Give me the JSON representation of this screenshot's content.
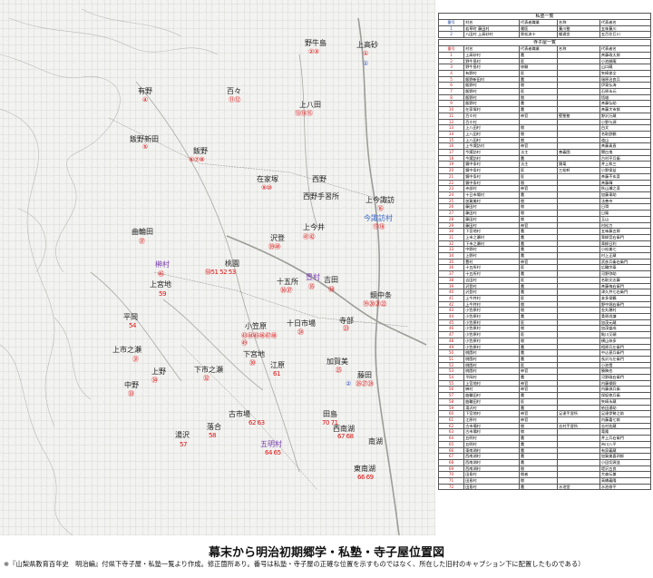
{
  "title": "幕末から明治初期郷学・私塾・寺子屋位置図",
  "note": "※『山梨県教育百年史　明治編』付県下寺子屋・私塾一覧より作成。修正箇所あり。番号は私塾・寺子屋の正確な位置を示すものではなく、所在した旧村のキャプション下に配置したものである）",
  "map": {
    "places": [
      {
        "name": "野牛島",
        "circles": "②③",
        "color": "black"
      },
      {
        "name": "上高砂",
        "circles": "①",
        "blue_circles": "①",
        "color": "black"
      },
      {
        "name": "有野",
        "circles": "④",
        "color": "black"
      },
      {
        "name": "百々",
        "circles": "⑪⑫",
        "color": "black"
      },
      {
        "name": "上八田",
        "circles": "⑬⑭⑮",
        "color": "black"
      },
      {
        "name": "飯野新田",
        "circles": "⑤",
        "color": "black"
      },
      {
        "name": "飯野",
        "circles": "⑥⑦⑧",
        "color": "black"
      },
      {
        "name": "在家塚",
        "circles": "⑨⑩",
        "color": "black"
      },
      {
        "name": "西野",
        "circles": "",
        "color": "black"
      },
      {
        "name": "西野手習所",
        "circles": "",
        "color": "black"
      },
      {
        "name": "上今諏訪",
        "circles": "⑯",
        "color": "black"
      },
      {
        "name": "今諏訪村",
        "circles": "⑰⑱",
        "color": "blue"
      },
      {
        "name": "曲輪田",
        "circles": "㊲",
        "color": "black"
      },
      {
        "name": "上今井",
        "circles": "㊶㊷",
        "color": "black"
      },
      {
        "name": "沢登",
        "circles": "㊴㊵",
        "color": "black"
      },
      {
        "name": "榊村",
        "circles": "㊻",
        "color": "purple"
      },
      {
        "name": "桃園",
        "circles": "㊿51 52 53",
        "color": "black"
      },
      {
        "name": "十五所",
        "circles": "㊱㊲",
        "color": "black"
      },
      {
        "name": "豊村",
        "circles": "㉟",
        "color": "purple"
      },
      {
        "name": "吉田",
        "circles": "㊳",
        "color": "black"
      },
      {
        "name": "上宮地",
        "circles": "59",
        "color": "black"
      },
      {
        "name": "鏡中条",
        "circles": "⑲⑳㉑㉒",
        "color": "black"
      },
      {
        "name": "平岡",
        "circles": "54",
        "color": "black"
      },
      {
        "name": "小笠原",
        "circles": "㊸㊹㊺㊻㊼㊽㊾",
        "color": "black"
      },
      {
        "name": "十日市場",
        "circles": "㉔",
        "color": "black"
      },
      {
        "name": "寺部",
        "circles": "㉓",
        "color": "black"
      },
      {
        "name": "上市之瀬",
        "circles": "㉛",
        "color": "black"
      },
      {
        "name": "下宮地",
        "circles": "㉚",
        "color": "black"
      },
      {
        "name": "加賀美",
        "circles": "㉕",
        "color": "black"
      },
      {
        "name": "上野",
        "circles": "㉞",
        "color": "black"
      },
      {
        "name": "下市之瀬",
        "circles": "㉜",
        "color": "black"
      },
      {
        "name": "江原",
        "circles": "61",
        "color": "black"
      },
      {
        "name": "藤田",
        "circles": "㉖㉗㉘",
        "blue_circles": "②",
        "color": "black"
      },
      {
        "name": "中野",
        "circles": "㉝",
        "color": "black"
      },
      {
        "name": "古市場",
        "circles": "62 63",
        "color": "black"
      },
      {
        "name": "落合",
        "circles": "58",
        "color": "black"
      },
      {
        "name": "田島",
        "circles": "70 71",
        "color": "black"
      },
      {
        "name": "西南湖",
        "circles": "67 68",
        "color": "black"
      },
      {
        "name": "湯沢",
        "circles": "57",
        "color": "black"
      },
      {
        "name": "五明村",
        "circles": "64 65",
        "color": "purple"
      },
      {
        "name": "南湖",
        "circles": "",
        "color": "black"
      },
      {
        "name": "東南湖",
        "circles": "66 69",
        "color": "black"
      }
    ]
  },
  "private_schools": {
    "title": "私塾一覧",
    "headers": [
      "番号",
      "村名",
      "代表者職業",
      "名称",
      "代表者名"
    ],
    "rows": [
      [
        "1",
        "若草町 藤田村",
        "儒医",
        "蒹川塾",
        "五味蒹川"
      ],
      [
        "2",
        "八田村 上高砂村",
        "黒松流十",
        "蝶適舎",
        "五百住巨川"
      ]
    ]
  },
  "temple_schools": {
    "title": "寺子屋一覧",
    "headers": [
      "番号",
      "村名",
      "代表者職業",
      "名称",
      "代表者名"
    ],
    "rows": [
      [
        "1",
        "上高砂村",
        "農",
        "",
        "斉藤政太郎"
      ],
      [
        "2",
        "野牛島村",
        "医",
        "",
        "小池順庵"
      ],
      [
        "3",
        "野牛島村",
        "修験",
        "",
        "山口蔵"
      ],
      [
        "4",
        "有野村",
        "医",
        "",
        "矢崎俊全"
      ],
      [
        "5",
        "飯野新田村",
        "農",
        "",
        "瑞原治良兵"
      ],
      [
        "6",
        "飯野村",
        "僧",
        "",
        "伊東弘海"
      ],
      [
        "7",
        "飯野村",
        "医",
        "",
        "石原永元"
      ],
      [
        "8",
        "飯野村",
        "僧",
        "",
        "悟雄"
      ],
      [
        "9",
        "飯野村",
        "農",
        "",
        "斉藤弘助"
      ],
      [
        "10",
        "在家塚村",
        "農",
        "",
        "斉藤大市郎"
      ],
      [
        "11",
        "百々村",
        "神官",
        "堅聖塾",
        "野沢万蔵"
      ],
      [
        "12",
        "百々村",
        "",
        "",
        "小野与源"
      ],
      [
        "13",
        "上八田村",
        "僧",
        "",
        "白文"
      ],
      [
        "14",
        "上八田村",
        "僧",
        "",
        "名取鉄観"
      ],
      [
        "15",
        "上八田村",
        "僧",
        "",
        "道山"
      ],
      [
        "16",
        "上今諏訪村",
        "神官",
        "",
        "斉藤真直"
      ],
      [
        "17",
        "今諏訪村",
        "法主",
        "善義園",
        "関白鬼"
      ],
      [
        "18",
        "今諏訪村",
        "農",
        "",
        "古村平兵衛"
      ],
      [
        "19",
        "鏡中条村",
        "法主",
        "鏡竜",
        "井上和三"
      ],
      [
        "20",
        "鏡中条村",
        "医",
        "三松軒",
        "小野保益"
      ],
      [
        "21",
        "鏡中条村",
        "医",
        "",
        "斉藤不玄斎"
      ],
      [
        "22",
        "鏡中条村",
        "僧",
        "",
        "斉藤輝"
      ],
      [
        "23",
        "寺部村",
        "神官",
        "",
        "秋山瀬之亟"
      ],
      [
        "24",
        "十日市場村",
        "農",
        "",
        "加藤東助"
      ],
      [
        "25",
        "加賀美村",
        "僧",
        "",
        "法善寺"
      ],
      [
        "26",
        "藤田村",
        "僧",
        "",
        "日滑"
      ],
      [
        "27",
        "藤田村",
        "僧",
        "",
        "日鳳"
      ],
      [
        "28",
        "藤田村",
        "僧",
        "",
        "玉山"
      ],
      [
        "29",
        "藤田村",
        "神官",
        "",
        "村松力"
      ],
      [
        "30",
        "下宮地村",
        "農",
        "",
        "五味藤五郎"
      ],
      [
        "31",
        "上市之瀬村",
        "農",
        "",
        "青柳音右衛門"
      ],
      [
        "32",
        "下市之瀬村",
        "農",
        "",
        "青柳日利"
      ],
      [
        "33",
        "中野村",
        "農",
        "",
        "小松美七"
      ],
      [
        "34",
        "上野村",
        "農",
        "",
        "村上正蔵"
      ],
      [
        "35",
        "豊村",
        "神官",
        "",
        "武彦兵衛右衛門"
      ],
      [
        "36",
        "十五所村",
        "医",
        "",
        "広輪宗泰"
      ],
      [
        "37",
        "十五所村",
        "農",
        "",
        "河野弥助"
      ],
      [
        "38",
        "吉田村",
        "医",
        "",
        "名取文志藤"
      ],
      [
        "39",
        "沢登村",
        "農",
        "",
        "斉藤梅右衛門"
      ],
      [
        "40",
        "沢登村",
        "農",
        "",
        "津久井七右衛門"
      ],
      [
        "41",
        "上今井村",
        "医",
        "",
        "本多保鶴"
      ],
      [
        "42",
        "上今井村",
        "僧",
        "",
        "野中堀右衛門"
      ],
      [
        "43",
        "小笠原村",
        "僧",
        "",
        "金丸穂村"
      ],
      [
        "44",
        "小笠原村",
        "農",
        "",
        "桑原尚謙"
      ],
      [
        "45",
        "小笠原村",
        "医",
        "",
        "加茂元蔵"
      ],
      [
        "46",
        "小笠原村",
        "僧",
        "",
        "加茂盛成"
      ],
      [
        "47",
        "小笠原村",
        "医",
        "",
        "鮎川又碩"
      ],
      [
        "48",
        "小笠原村",
        "僧",
        "",
        "横山恭多"
      ],
      [
        "49",
        "小笠原村",
        "農",
        "",
        "相原兵左衛門"
      ],
      [
        "50",
        "桃園村",
        "農",
        "",
        "中込甚兵衛門"
      ],
      [
        "51",
        "桃園村",
        "農",
        "",
        "長沢与左衛門"
      ],
      [
        "52",
        "桃園村",
        "医",
        "",
        "小池雪"
      ],
      [
        "53",
        "桃園村",
        "神官",
        "",
        "勝稿也"
      ],
      [
        "54",
        "平岡村",
        "農",
        "",
        "河野政右衛門"
      ],
      [
        "55",
        "上宮地村",
        "神官",
        "",
        "内藤操照"
      ],
      [
        "56",
        "榊村",
        "神官",
        "",
        "内藤源兵衛"
      ],
      [
        "57",
        "曲輪田村",
        "農",
        "",
        "保坂徳兵衛"
      ],
      [
        "58",
        "曲輪田村",
        "医",
        "",
        "矢崎永蔵"
      ],
      [
        "59",
        "湯沢村",
        "農",
        "",
        "依田遠助"
      ],
      [
        "60",
        "下宮地村",
        "神官",
        "足達手習所",
        "足達伊勢之助"
      ],
      [
        "61",
        "江原村",
        "神官",
        "",
        "内藤嘉七郎"
      ],
      [
        "62",
        "古市場村",
        "僧",
        "志村手習所",
        "志村佐蔵"
      ],
      [
        "63",
        "古市場村",
        "僧",
        "",
        "竜隆"
      ],
      [
        "64",
        "五明村",
        "農",
        "",
        "井上兵右衛門"
      ],
      [
        "65",
        "五明村",
        "農",
        "",
        "市川八平"
      ],
      [
        "66",
        "東南湖村",
        "農",
        "",
        "有泉義蔵"
      ],
      [
        "67",
        "西南湖村",
        "農",
        "",
        "加賀美喜四郎"
      ],
      [
        "68",
        "西南湖村",
        "農",
        "",
        "小田切源並"
      ],
      [
        "69",
        "西南湖村",
        "僧",
        "",
        "堤沢五良"
      ],
      [
        "70",
        "田島村",
        "僧者",
        "",
        "大森伝兼"
      ],
      [
        "71",
        "田島村",
        "僧",
        "",
        "高橋義隆"
      ],
      [
        "72",
        "田島村",
        "農",
        "水池堂",
        "水池修平"
      ]
    ]
  },
  "colors": {
    "temple_number": "#d11111",
    "private_number": "#2d55c8",
    "purple_label": "#7a3fb0"
  }
}
